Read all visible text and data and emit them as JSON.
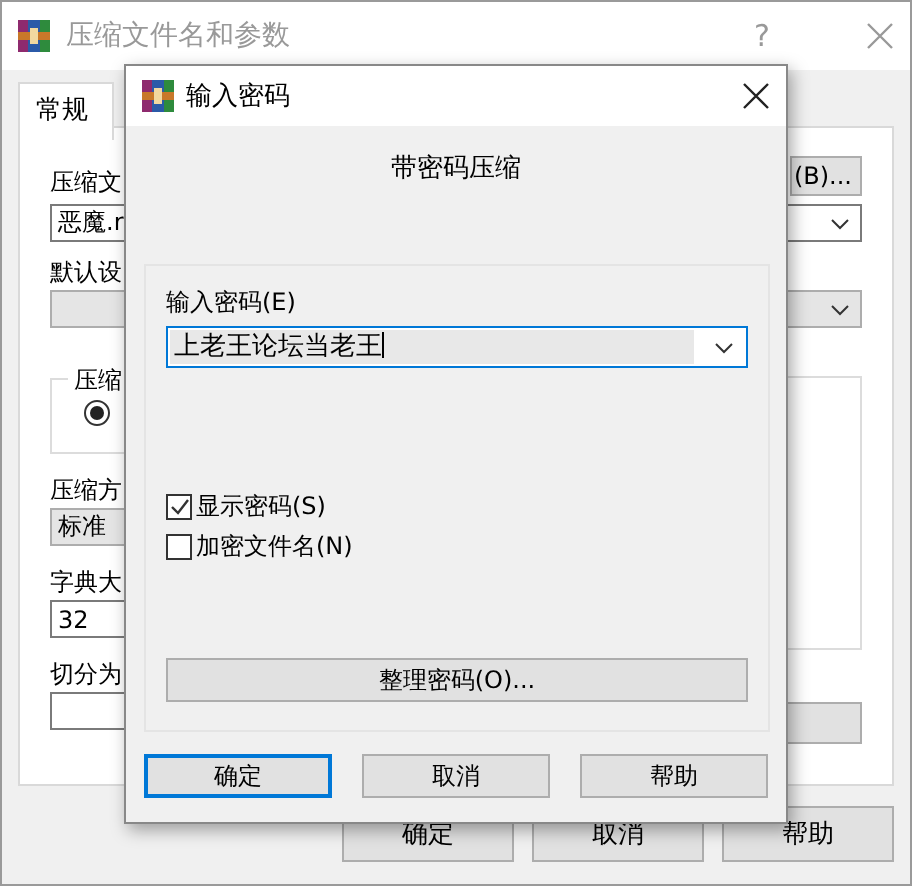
{
  "window": {
    "title": "压缩文件名和参数",
    "help": "?"
  },
  "tabs": [
    {
      "label": "常规",
      "selected": true
    }
  ],
  "archive_name": {
    "label": "压缩文",
    "value": "恶魔.r",
    "browse_button": "(B)..."
  },
  "profile": {
    "label": "默认设"
  },
  "archive_format": {
    "label": "压缩",
    "radio": {
      "selected": true
    }
  },
  "method": {
    "label": "压缩方",
    "value": "标准"
  },
  "dictionary": {
    "label": "字典大",
    "value": "32"
  },
  "split": {
    "label": "切分为"
  },
  "buttons": [
    "确定",
    "取消",
    "帮助"
  ],
  "password_dialog": {
    "title": "输入密码",
    "heading": "带密码压缩",
    "password_label": "输入密码(E)",
    "password_value": "上老王论坛当老王",
    "options": [
      {
        "label": "显示密码(S)",
        "checked": true
      },
      {
        "label": "加密文件名(N)",
        "checked": false
      }
    ],
    "organize_button": "整理密码(O)...",
    "buttons": [
      {
        "label": "确定",
        "default": true
      },
      {
        "label": "取消",
        "default": false
      },
      {
        "label": "帮助",
        "default": false
      }
    ]
  }
}
